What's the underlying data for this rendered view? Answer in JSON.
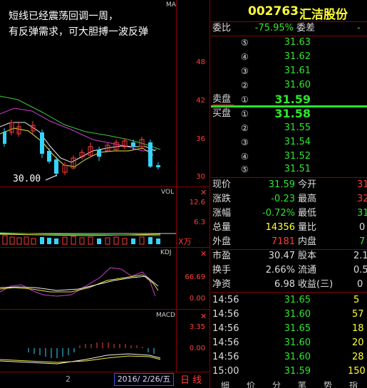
{
  "stock": {
    "code": "002763",
    "name": "汇洁股份"
  },
  "annotation": {
    "line1": "短线已经震荡回调一周，",
    "line2": "有反弹需求，可大胆搏一波反弹"
  },
  "price_chart": {
    "label": "MA",
    "yticks": [
      "48",
      "42",
      "36",
      "30"
    ],
    "low_marker": "30.00"
  },
  "vol_panel": {
    "label": "VOL",
    "yticks": [
      "12.6",
      "6.3"
    ],
    "unit": "X万"
  },
  "kdj_panel": {
    "label": "KDJ",
    "yticks": [
      "66.69",
      "0.00"
    ]
  },
  "macd_panel": {
    "label": "MACD",
    "yticks": [
      "3.35",
      "0.00"
    ]
  },
  "bottom_bar": {
    "num": "2",
    "date": "2016/ 2/26/五",
    "period": "日 线"
  },
  "quote": {
    "weibi_label": "委比",
    "weibi": "-75.95%",
    "weicha_label": "委差",
    "weicha": "-",
    "asks": [
      {
        "n": "⑤",
        "price": "31.63"
      },
      {
        "n": "④",
        "price": "31.62"
      },
      {
        "n": "③",
        "price": "31.61"
      },
      {
        "n": "②",
        "price": "31.60"
      },
      {
        "n": "①",
        "price": "31.59",
        "label": "卖盘"
      }
    ],
    "bids": [
      {
        "n": "①",
        "price": "31.58",
        "label": "买盘"
      },
      {
        "n": "②",
        "price": "31.55"
      },
      {
        "n": "③",
        "price": "31.54"
      },
      {
        "n": "④",
        "price": "31.52"
      },
      {
        "n": "⑤",
        "price": "31.51"
      }
    ],
    "stats": [
      {
        "l1": "现价",
        "v1": "31.59",
        "l2": "今开",
        "v2": "31"
      },
      {
        "l1": "涨跌",
        "v1": "-0.23",
        "l2": "最高",
        "v2": "32"
      },
      {
        "l1": "涨幅",
        "v1": "-0.72%",
        "l2": "最低",
        "v2": "31"
      },
      {
        "l1": "总量",
        "v1": "14356",
        "l2": "量比",
        "v2": "0"
      },
      {
        "l1": "外盘",
        "v1": "7181",
        "l2": "内盘",
        "v2": "7"
      }
    ],
    "fund": [
      {
        "l1": "市盈",
        "v1": "30.47",
        "l2": "股本",
        "v2": "2.1"
      },
      {
        "l1": "换手",
        "v1": "2.66%",
        "l2": "流通",
        "v2": "0.5"
      },
      {
        "l1": "净资",
        "v1": "6.98",
        "l2": "收益(三)",
        "v2": "0"
      }
    ],
    "ticks": [
      {
        "t": "14:56",
        "p": "31.65",
        "v": "5"
      },
      {
        "t": "14:56",
        "p": "31.60",
        "v": "57"
      },
      {
        "t": "14:56",
        "p": "31.65",
        "v": "18"
      },
      {
        "t": "14:56",
        "p": "31.60",
        "v": "20"
      },
      {
        "t": "14:56",
        "p": "31.60",
        "v": "28"
      },
      {
        "t": "15:00",
        "p": "31.59",
        "v": "150"
      }
    ],
    "footer": [
      "细",
      "价",
      "分",
      "笔",
      "势",
      "指"
    ]
  }
}
